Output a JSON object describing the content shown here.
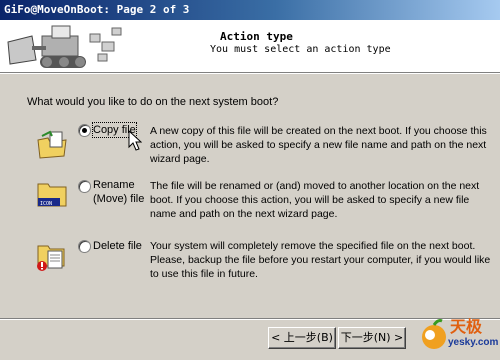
{
  "window": {
    "title": "GiFo@MoveOnBoot: Page 2 of 3"
  },
  "header": {
    "title": "Action type",
    "subtitle": "You must select an action type"
  },
  "question": "What would you like to do on the next system boot?",
  "options": [
    {
      "label": "Copy file",
      "checked": true,
      "icon": "copy-file-icon",
      "desc": "A new copy of this file will be created on the next boot. If you choose this action, you will be asked to specify a new file name and path on the next wizard page."
    },
    {
      "label": "Rename (Move) file",
      "checked": false,
      "icon": "rename-move-file-icon",
      "desc": "The file will be renamed or (and) moved to another location on the next boot. If you choose this action, you will be asked to specify a new file name and path on the next wizard page."
    },
    {
      "label": "Delete file",
      "checked": false,
      "icon": "delete-file-icon",
      "desc": "Your system will completely remove the specified file on the next boot. Please, backup the file before you restart your computer, if you would like to use this file in future."
    }
  ],
  "buttons": {
    "back": "< 上一步(B)",
    "next": "下一步(N) >"
  },
  "watermark": {
    "brand": "天极",
    "site": "yesky.com"
  }
}
